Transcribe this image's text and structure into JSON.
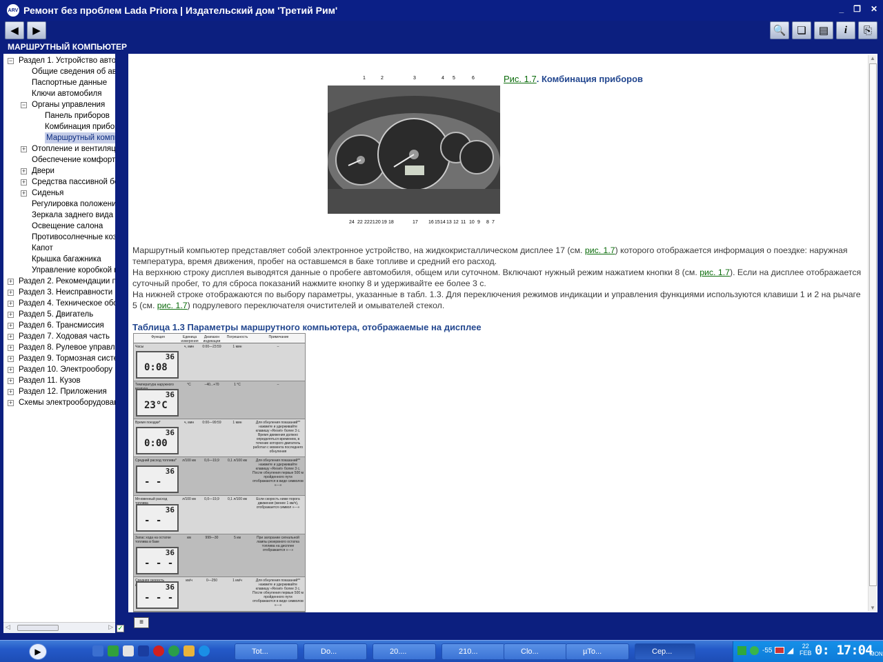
{
  "window": {
    "title": "Ремонт без проблем Lada Priora | Издательский дом 'Третий Рим'",
    "app_icon": "ARV"
  },
  "nav": {
    "back_icon": "arrow-left-icon",
    "forward_icon": "arrow-right-icon"
  },
  "section_title": "МАРШРУТНЫЙ КОМПЬЮТЕР",
  "tree": {
    "items": [
      {
        "label": "Раздел 1. Устройство авто",
        "expander": "−"
      },
      {
        "label": "Общие сведения об авт"
      },
      {
        "label": "Паспортные данные"
      },
      {
        "label": "Ключи автомобиля"
      },
      {
        "label": "Органы управления",
        "expander": "−"
      },
      {
        "label": "Панель приборов"
      },
      {
        "label": "Комбинация прибор"
      },
      {
        "label": "Маршрутный компь"
      },
      {
        "label": "Отопление и вентиляци",
        "expander": "+"
      },
      {
        "label": "Обеспечение комфорт"
      },
      {
        "label": "Двери",
        "expander": "+"
      },
      {
        "label": "Средства пассивной бе",
        "expander": "+"
      },
      {
        "label": "Сиденья",
        "expander": "+"
      },
      {
        "label": "Регулировка положени"
      },
      {
        "label": "Зеркала заднего вида"
      },
      {
        "label": "Освещение салона"
      },
      {
        "label": "Противосолнечные коз"
      },
      {
        "label": "Капот"
      },
      {
        "label": "Крышка багажника"
      },
      {
        "label": "Управление коробкой п"
      },
      {
        "label": "Раздел 2. Рекомендации п",
        "expander": "+"
      },
      {
        "label": "Раздел 3. Неисправности в",
        "expander": "+"
      },
      {
        "label": "Раздел 4. Техническое обс",
        "expander": "+"
      },
      {
        "label": "Раздел 5. Двигатель",
        "expander": "+"
      },
      {
        "label": "Раздел 6. Трансмиссия",
        "expander": "+"
      },
      {
        "label": "Раздел 7. Ходовая часть",
        "expander": "+"
      },
      {
        "label": "Раздел 8. Рулевое управле",
        "expander": "+"
      },
      {
        "label": "Раздел 9. Тормозная систе",
        "expander": "+"
      },
      {
        "label": "Раздел 10. Электрообору",
        "expander": "+"
      },
      {
        "label": "Раздел 11. Кузов",
        "expander": "+"
      },
      {
        "label": "Раздел 12. Приложения",
        "expander": "+"
      },
      {
        "label": "Схемы электрооборудован",
        "expander": "+"
      }
    ]
  },
  "figure": {
    "link": "Рис. 1.7",
    "caption": ". Комбинация приборов",
    "top_numbers": [
      "1",
      "2",
      "3",
      "4",
      "5",
      "6"
    ],
    "bottom_numbers": [
      "24",
      "22",
      "22",
      "21",
      "20",
      "19",
      "18",
      "17",
      "16",
      "15",
      "14",
      "13",
      "12",
      "11",
      "10",
      "9",
      "8",
      "7"
    ]
  },
  "paragraphs": {
    "p1_a": "Маршрутный компьютер представляет собой электронное устройство, на жидкокристаллическом дисплее 17 (см. ",
    "p1_link": "рис. 1.7",
    "p1_b": ") которого отображается информация о поездке: наружная температура, время движения, пробег на оставшемся в баке топливе и средний его расход.",
    "p2_a": "На верхнюю строку дисплея выводятся данные о пробеге автомобиля, общем или суточном. Включают нужный режим нажатием кнопки 8 (см. ",
    "p2_link": "рис. 1.7",
    "p2_b": "). Если на дисплее отображается суточный пробег, то для сброса показаний нажмите кнопку 8 и удерживайте ее более 3 с.",
    "p3_a": "На нижней строке отображаются по выбору параметры, указанные в табл. 1.3. Для переключения режимов индикации и управления функциями используются клавиши 1 и 2 на рычаге 5 (см. ",
    "p3_link": "рис. 1.7",
    "p3_b": ") подрулевого переключателя очистителей и омывателей стекол."
  },
  "table": {
    "title": "Таблица 1.3 Параметры маршрутного компьютера, отображаемые на дисплее",
    "headers": [
      "Функция",
      "Единица измерения",
      "Диапазон индикации",
      "Погрешность",
      "Примечание"
    ],
    "rows": [
      {
        "func": "Часы",
        "unit": "ч, мин",
        "range": "0:00—23:59",
        "err": "1 мин",
        "note": "–",
        "lcd_top": "36",
        "lcd_main": "0:08"
      },
      {
        "func": "Температура наружного воздуха",
        "unit": "°С",
        "range": "−40...+70",
        "err": "1 °С",
        "note": "–",
        "lcd_top": "36",
        "lcd_main": "23°C"
      },
      {
        "func": "Время поездки*",
        "unit": "ч, мин",
        "range": "0:00—99:59",
        "err": "1 мин",
        "note": "Для обнуления показаний** нажмите и удерживайте клавишу «Reset» более 3 с. Время движения должно определяться временем, в течение которого двигатель работал с момента последнего обнуления",
        "lcd_top": "36",
        "lcd_main": "0:00"
      },
      {
        "func": "Средний расход топлива*",
        "unit": "л/100 км",
        "range": "0,0—19,9",
        "err": "0,1 л/100 км",
        "note": "Для обнуления показаний** нажмите и удерживайте клавишу «Reset» более 3 с. После обнуления первые 500 м пройденного пути отображаются в виде символов «---»",
        "lcd_top": "36",
        "lcd_main": "- -"
      },
      {
        "func": "Мгновенный расход топлива",
        "unit": "л/100 км",
        "range": "0,0—19,9",
        "err": "0,1 л/100 км",
        "note": "Если скорость ниже порога движения (менее 1 км/ч), отображается символ «---»",
        "lcd_top": "36",
        "lcd_main": "- -"
      },
      {
        "func": "Запас хода на остатке топлива в баке",
        "unit": "км",
        "range": "999—30",
        "err": "5 км",
        "note": "При загорании сигнальной лампы резервного остатка топлива на дисплее отображается «---»",
        "lcd_top": "36",
        "lcd_main": "- - -"
      },
      {
        "func": "Средняя скорость движения*",
        "unit": "км/ч",
        "range": "0—250",
        "err": "1 км/ч",
        "note": "Для обнуления показаний** нажмите и удерживайте клавишу «Reset» более 3 с. После обнуления первые 500 м пройденного пути отображаются в виде символов «---»",
        "lcd_top": "36",
        "lcd_main": "- - -"
      }
    ]
  },
  "taskbar": {
    "tasks": [
      "Tot...",
      "Do...",
      "20....",
      "210...",
      "Clo...",
      "µTo...",
      "Сер..."
    ],
    "tray_temp": "-55",
    "date_day": "22",
    "date_month": "FEB",
    "time": "0: 17:04",
    "weekday": "MON"
  },
  "colors": {
    "frame": "#0c1f7f",
    "heading": "#23478f",
    "link": "#0a6b0a"
  }
}
